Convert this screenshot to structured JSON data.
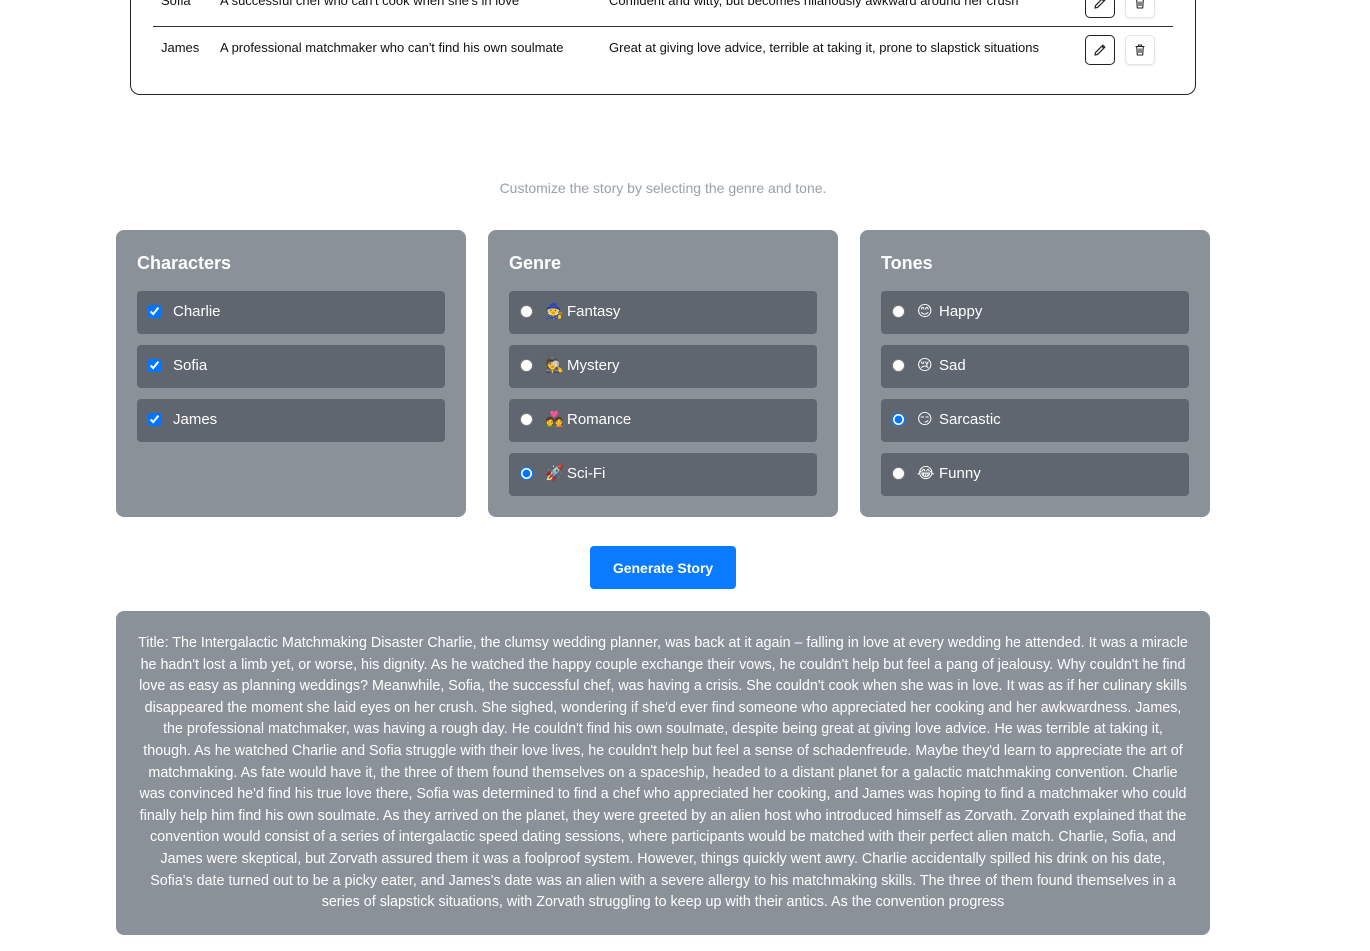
{
  "characters_table": {
    "rows": [
      {
        "name": "Sofia",
        "description": "A successful chef who can't cook when she's in love",
        "personality": "Confident and witty, but becomes hilariously awkward around her crush"
      },
      {
        "name": "James",
        "description": "A professional matchmaker who can't find his own soulmate",
        "personality": "Great at giving love advice, terrible at taking it, prone to slapstick situations"
      }
    ],
    "edit_icon": "pencil-icon",
    "delete_icon": "trash-icon"
  },
  "subtitle": "Customize the story by selecting the genre and tone.",
  "characters_panel": {
    "title": "Characters",
    "options": [
      {
        "label": "Charlie",
        "checked": true
      },
      {
        "label": "Sofia",
        "checked": true
      },
      {
        "label": "James",
        "checked": true
      }
    ]
  },
  "genre_panel": {
    "title": "Genre",
    "options": [
      {
        "emoji": "🧙",
        "label": "Fantasy",
        "selected": false
      },
      {
        "emoji": "🕵️",
        "label": "Mystery",
        "selected": false
      },
      {
        "emoji": "💑",
        "label": "Romance",
        "selected": false
      },
      {
        "emoji": "🚀",
        "label": "Sci-Fi",
        "selected": true
      }
    ]
  },
  "tones_panel": {
    "title": "Tones",
    "options": [
      {
        "emoji": "😊",
        "label": "Happy",
        "selected": false
      },
      {
        "emoji": "😢",
        "label": "Sad",
        "selected": false
      },
      {
        "emoji": "😏",
        "label": "Sarcastic",
        "selected": true
      },
      {
        "emoji": "😂",
        "label": "Funny",
        "selected": false
      }
    ]
  },
  "generate_button": "Generate Story",
  "story_text": "Title: The Intergalactic Matchmaking Disaster Charlie, the clumsy wedding planner, was back at it again – falling in love at every wedding he attended. It was a miracle he hadn't lost a limb yet, or worse, his dignity. As he watched the happy couple exchange their vows, he couldn't help but feel a pang of jealousy. Why couldn't he find love as easy as planning weddings? Meanwhile, Sofia, the successful chef, was having a crisis. She couldn't cook when she was in love. It was as if her culinary skills disappeared the moment she laid eyes on her crush. She sighed, wondering if she'd ever find someone who appreciated her cooking and her awkwardness. James, the professional matchmaker, was having a rough day. He couldn't find his own soulmate, despite being great at giving love advice. He was terrible at taking it, though. As he watched Charlie and Sofia struggle with their love lives, he couldn't help but feel a sense of schadenfreude. Maybe they'd learn to appreciate the art of matchmaking. As fate would have it, the three of them found themselves on a spaceship, headed to a distant planet for a galactic matchmaking convention. Charlie was convinced he'd find his true love there, Sofia was determined to find a chef who appreciated her cooking, and James was hoping to find a matchmaker who could finally help him find his own soulmate. As they arrived on the planet, they were greeted by an alien host who introduced himself as Zorvath. Zorvath explained that the convention would consist of a series of intergalactic speed dating sessions, where participants would be matched with their perfect alien match. Charlie, Sofia, and James were skeptical, but Zorvath assured them it was a foolproof system. However, things quickly went awry. Charlie accidentally spilled his drink on his date, Sofia's date turned out to be a picky eater, and James's date was an alien with a severe allergy to his matchmaking skills. The three of them found themselves in a series of slapstick situations, with Zorvath struggling to keep up with their antics. As the convention progress",
  "colors": {
    "accent": "#0a7aff",
    "panel_bg": "#8b9199",
    "option_bg": "#5f6670",
    "subtitle": "#9aa0a6"
  }
}
